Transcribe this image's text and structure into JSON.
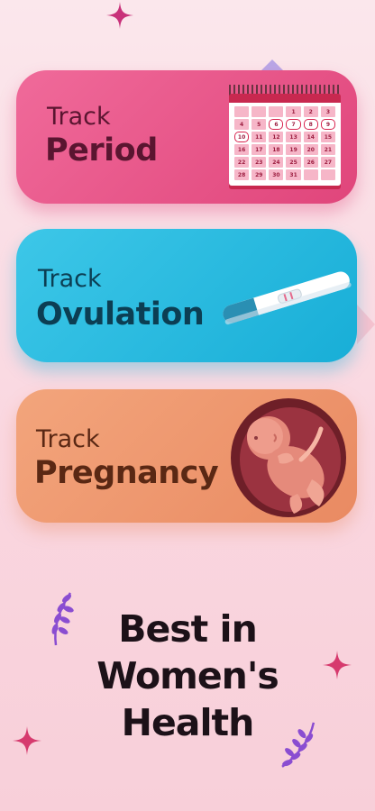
{
  "cards": [
    {
      "small": "Track",
      "big": "Period",
      "color": "#e0457b"
    },
    {
      "small": "Track",
      "big": "Ovulation",
      "color": "#18aed7"
    },
    {
      "small": "Track",
      "big": "Pregnancy",
      "color": "#e98a62"
    }
  ],
  "calendar": {
    "days": [
      "",
      "",
      "",
      "1",
      "2",
      "3",
      "4",
      "5",
      "6",
      "7",
      "8",
      "9",
      "10",
      "11",
      "12",
      "13",
      "14",
      "15",
      "16",
      "17",
      "18",
      "19",
      "20",
      "21",
      "22",
      "23",
      "24",
      "25",
      "26",
      "27",
      "28",
      "29",
      "30",
      "31",
      "",
      ""
    ],
    "period_days": [
      "6",
      "7",
      "8",
      "9",
      "10"
    ]
  },
  "tagline": {
    "line1": "Best in",
    "line2": "Women's",
    "line3": "Health"
  },
  "colors": {
    "sparkle": "#d63a6e",
    "laurel": "#8a4dd1",
    "background": "#fad7e0"
  }
}
